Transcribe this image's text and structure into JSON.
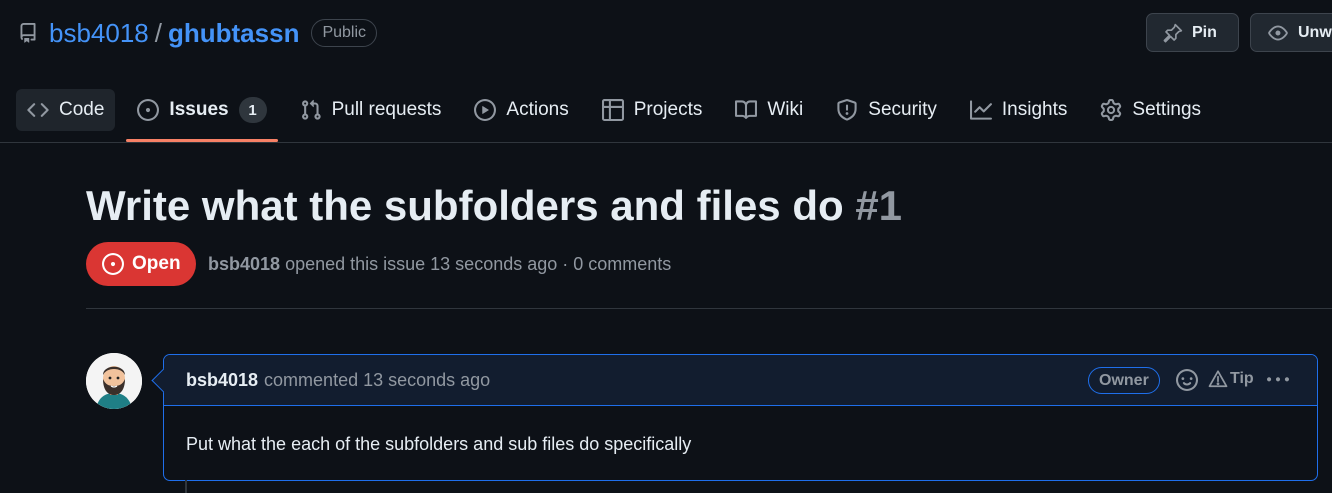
{
  "repo": {
    "owner": "bsb4018",
    "separator": "/",
    "name": "ghubtassn",
    "visibility": "Public",
    "pin_label": "Pin",
    "watch_label": "Unwa"
  },
  "tabs": [
    {
      "label": "Code",
      "icon": "code-icon"
    },
    {
      "label": "Issues",
      "icon": "issue-opened-icon",
      "count": "1"
    },
    {
      "label": "Pull requests",
      "icon": "git-pull-request-icon"
    },
    {
      "label": "Actions",
      "icon": "play-icon"
    },
    {
      "label": "Projects",
      "icon": "table-icon"
    },
    {
      "label": "Wiki",
      "icon": "book-icon"
    },
    {
      "label": "Security",
      "icon": "shield-icon"
    },
    {
      "label": "Insights",
      "icon": "graph-icon"
    },
    {
      "label": "Settings",
      "icon": "gear-icon"
    }
  ],
  "active_tab": "Issues",
  "issue": {
    "title": "Write what the subfolders and files do",
    "number": "#1",
    "state": "Open",
    "author": "bsb4018",
    "meta": "opened this issue 13 seconds ago · 0 comments"
  },
  "comment": {
    "author": "bsb4018",
    "meta": "commented 13 seconds ago",
    "badge": "Owner",
    "tip_label": "Tip",
    "body": "Put what the each of the subfolders and sub files do specifically"
  },
  "colors": {
    "background": "#0d1117",
    "link": "#4493f8",
    "open_state": "#da3633",
    "active_tab_underline": "#f78166",
    "comment_border": "#1f6feb"
  }
}
